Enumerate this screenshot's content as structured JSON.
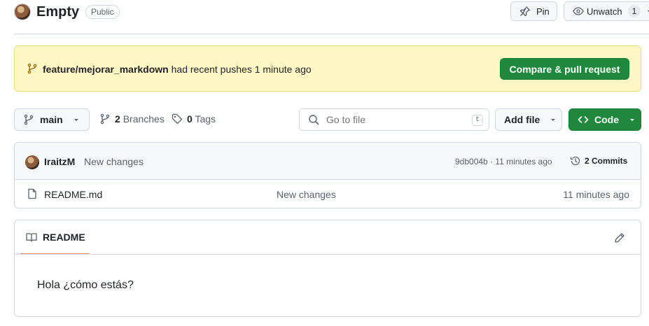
{
  "header": {
    "repo_name": "Empty",
    "visibility": "Public",
    "pin_label": "Pin",
    "watch_label": "Unwatch",
    "watch_count": "1"
  },
  "banner": {
    "branch": "feature/mejorar_markdown",
    "text": "had recent pushes 1 minute ago",
    "compare_label": "Compare & pull request"
  },
  "toolbar": {
    "branch": "main",
    "branches_count": "2",
    "branches_label": "Branches",
    "tags_count": "0",
    "tags_label": "Tags",
    "goto_placeholder": "Go to file",
    "goto_kbd": "t",
    "addfile_label": "Add file",
    "code_label": "Code"
  },
  "commit": {
    "author": "IraitzM",
    "message": "New changes",
    "meta": "9db004b · 11 minutes ago",
    "commits_label": "2 Commits"
  },
  "files": [
    {
      "name": "README.md",
      "message": "New changes",
      "time": "11 minutes ago"
    }
  ],
  "readme": {
    "tab_label": "README",
    "content": "Hola ¿cómo estás?"
  },
  "colors": {
    "primary_green": "#1f883d",
    "banner_bg": "#fff8c5",
    "tab_underline": "#fd8c73"
  }
}
